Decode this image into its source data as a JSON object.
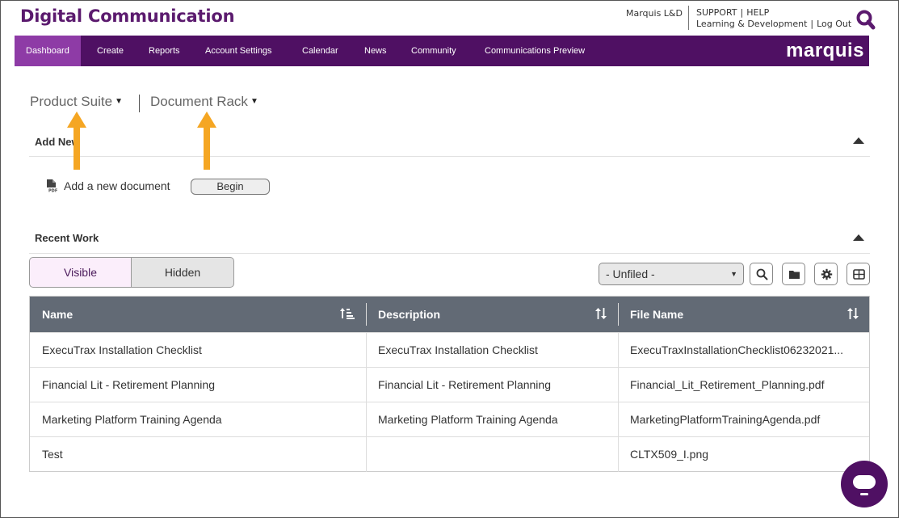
{
  "header": {
    "app_title": "Digital Communication",
    "user": "Marquis L&D",
    "support": "SUPPORT",
    "help": "HELP",
    "learning": "Learning & Development",
    "logout": "Log Out",
    "search_icon": "search-icon"
  },
  "nav": {
    "items": [
      "Dashboard",
      "Create",
      "Reports",
      "Account Settings",
      "Calendar",
      "News",
      "Community",
      "Communications Preview"
    ],
    "active": "Dashboard",
    "brand": "marquis"
  },
  "selectors": {
    "product_suite": "Product Suite",
    "document_rack": "Document Rack"
  },
  "add_new": {
    "title": "Add New",
    "label": "Add a new document",
    "begin": "Begin"
  },
  "recent_work": {
    "title": "Recent Work",
    "visible": "Visible",
    "hidden": "Hidden",
    "folder_filter": "- Unfiled -"
  },
  "table": {
    "headers": [
      "Name",
      "Description",
      "File Name"
    ],
    "rows": [
      [
        "ExecuTrax Installation Checklist",
        "ExecuTrax Installation Checklist",
        "ExecuTraxInstallationChecklist06232021..."
      ],
      [
        "Financial Lit - Retirement Planning",
        "Financial Lit - Retirement Planning",
        "Financial_Lit_Retirement_Planning.pdf"
      ],
      [
        "Marketing Platform Training Agenda",
        "Marketing Platform Training Agenda",
        "MarketingPlatformTrainingAgenda.pdf"
      ],
      [
        "Test",
        "",
        "CLTX509_I.png"
      ]
    ]
  },
  "colors": {
    "brand_purple": "#4f1063",
    "active_nav": "#8e3ba6",
    "annotation_arrow": "#f5a623",
    "table_header": "#626a75"
  }
}
